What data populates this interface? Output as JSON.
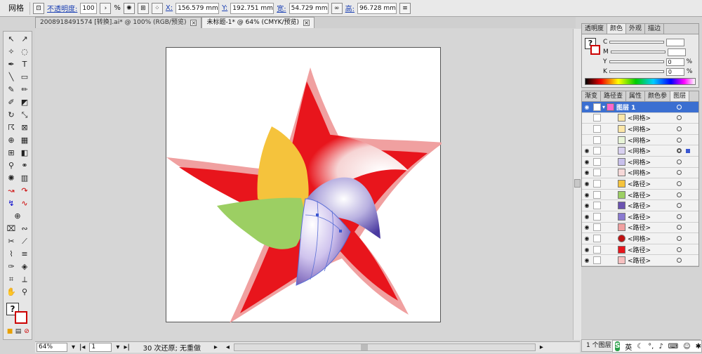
{
  "toolbar": {
    "mode": "网格",
    "opacity_label": "不透明度:",
    "opacity_value": "100",
    "percent": "%",
    "x_label": "X:",
    "x_value": "156.579 mm",
    "y_label": "Y:",
    "y_value": "192.751 mm",
    "w_label": "宽:",
    "w_value": "54.729 mm",
    "h_label": "高:",
    "h_value": "96.728 mm"
  },
  "tabs": [
    {
      "label": "20089184915​74 [转换].ai* @ 100% (RGB/预览)"
    },
    {
      "label": "未标题-1* @ 64% (CMYK/预览)"
    }
  ],
  "status": {
    "zoom": "64%",
    "page": "1",
    "undo": "30 次还原; 无重做"
  },
  "color_panel": {
    "tabs": [
      "透明度",
      "颜色",
      "外观",
      "描边"
    ],
    "rows": [
      {
        "label": "C",
        "value": ""
      },
      {
        "label": "M",
        "value": ""
      },
      {
        "label": "Y",
        "value": "0"
      },
      {
        "label": "K",
        "value": "0"
      }
    ],
    "pct": "%"
  },
  "layers_panel": {
    "tabs": [
      "渐变",
      "路径查",
      "属性",
      "颜色参",
      "图层"
    ],
    "layer_name": "图层 1",
    "items": [
      "<网格>",
      "<网格>",
      "<网格>",
      "<网格>",
      "<网格>",
      "<网格>",
      "<路径>",
      "<路径>",
      "<路径>",
      "<路径>",
      "<路径>",
      "<网格>",
      "<路径>",
      "<路径>"
    ],
    "footer": "1 个图层"
  },
  "ime": {
    "lang": "英"
  },
  "colors": {
    "star_outer": "#f0a0a0",
    "star_inner": "#e8151c",
    "yellow": "#f5c33c",
    "green": "#9ccf63",
    "purple": "#7a6ab8"
  }
}
